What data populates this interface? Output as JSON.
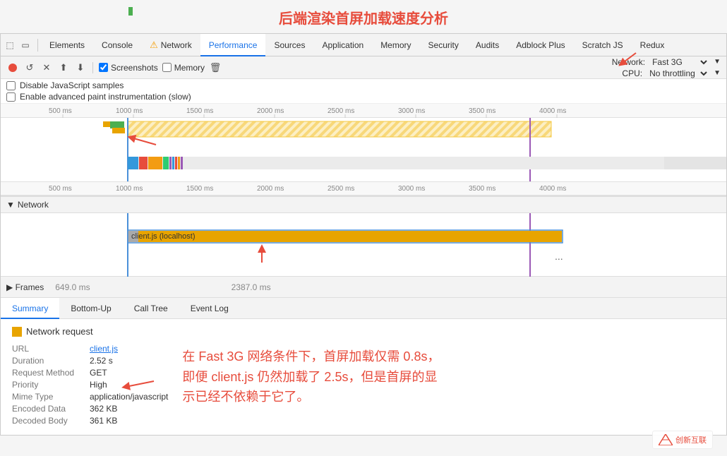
{
  "page": {
    "title": "后端渲染首屏加载速度分析"
  },
  "tabs": {
    "items": [
      {
        "id": "elements",
        "label": "Elements",
        "active": false
      },
      {
        "id": "console",
        "label": "Console",
        "active": false
      },
      {
        "id": "network",
        "label": "Network",
        "active": false,
        "hasWarning": true
      },
      {
        "id": "performance",
        "label": "Performance",
        "active": true
      },
      {
        "id": "sources",
        "label": "Sources",
        "active": false
      },
      {
        "id": "application",
        "label": "Application",
        "active": false
      },
      {
        "id": "memory",
        "label": "Memory",
        "active": false
      },
      {
        "id": "security",
        "label": "Security",
        "active": false
      },
      {
        "id": "audits",
        "label": "Audits",
        "active": false
      },
      {
        "id": "adblock",
        "label": "Adblock Plus",
        "active": false
      },
      {
        "id": "scratch",
        "label": "Scratch JS",
        "active": false
      },
      {
        "id": "redux",
        "label": "Redux",
        "active": false
      }
    ]
  },
  "toolbar": {
    "screenshots_label": "Screenshots",
    "memory_label": "Memory",
    "network_label": "Network:",
    "network_value": "Fast 3G",
    "cpu_label": "CPU:",
    "cpu_value": "No throttling"
  },
  "options": {
    "disable_js_label": "Disable JavaScript samples",
    "enable_paint_label": "Enable advanced paint instrumentation (slow)"
  },
  "ruler": {
    "marks": [
      "500 ms",
      "1000 ms",
      "1500 ms",
      "2000 ms",
      "2500 ms",
      "3000 ms",
      "3500 ms",
      "4000 ms"
    ]
  },
  "network_section": {
    "label": "Network",
    "bar_label": "client.js (localhost)",
    "bar_duration": "2.52 s"
  },
  "frames_section": {
    "label": "▶ Frames",
    "time1": "649.0 ms",
    "time2": "2387.0 ms"
  },
  "bottom_tabs": {
    "items": [
      {
        "id": "summary",
        "label": "Summary",
        "active": true
      },
      {
        "id": "bottom-up",
        "label": "Bottom-Up",
        "active": false
      },
      {
        "id": "call-tree",
        "label": "Call Tree",
        "active": false
      },
      {
        "id": "event-log",
        "label": "Event Log",
        "active": false
      }
    ]
  },
  "summary": {
    "header": "Network request",
    "details": [
      {
        "label": "URL",
        "value": "client.js",
        "isLink": true
      },
      {
        "label": "Duration",
        "value": "2.52 s"
      },
      {
        "label": "Request Method",
        "value": "GET"
      },
      {
        "label": "Priority",
        "value": "High"
      },
      {
        "label": "Mime Type",
        "value": "application/javascript"
      },
      {
        "label": "Encoded Data",
        "value": "362 KB"
      },
      {
        "label": "Decoded Body",
        "value": "361 KB"
      }
    ],
    "annotation": "在 Fast 3G 网络条件下，首屏加载仅需 0.8s，\n即便 client.js 仍然加载了 2.5s，但是首屏的显\n示已经不依赖于它了。"
  },
  "brand": {
    "name": "创新互联"
  }
}
